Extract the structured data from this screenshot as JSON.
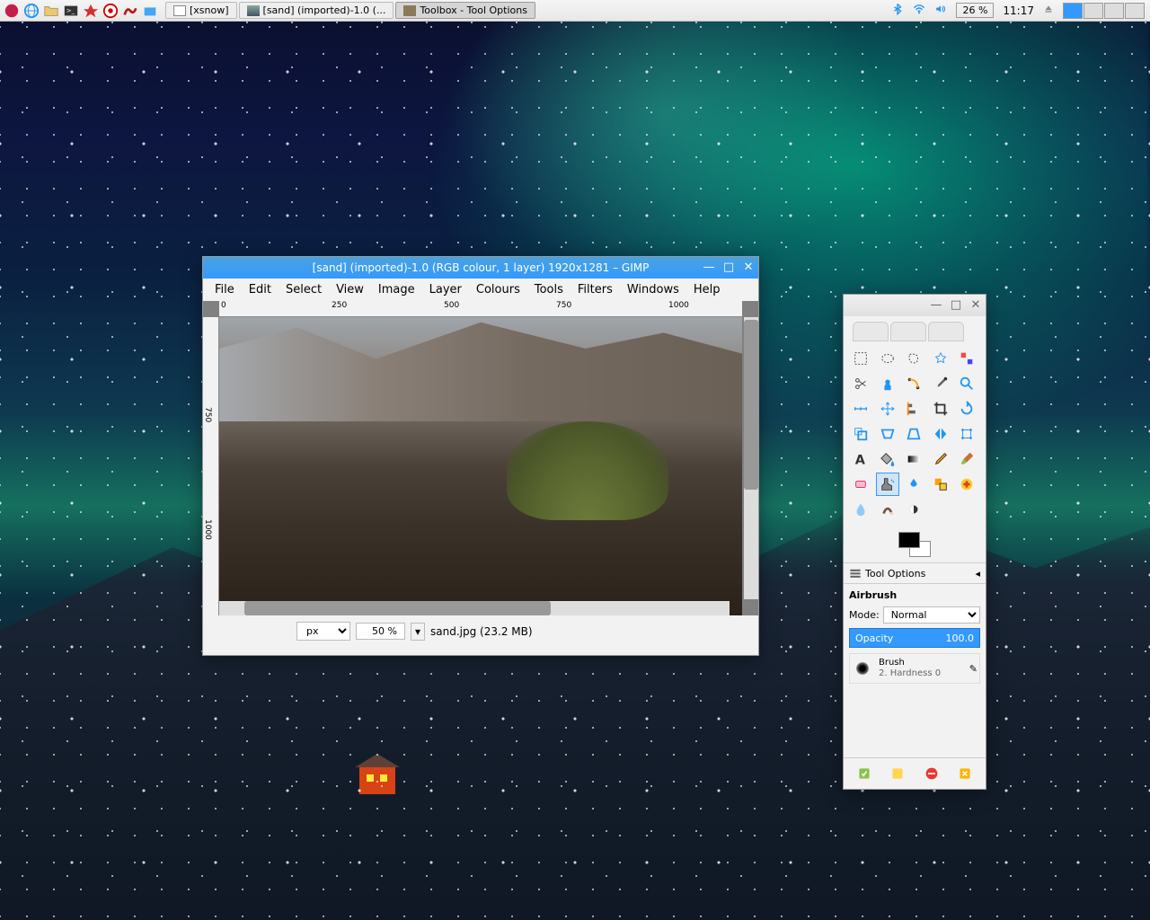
{
  "taskbar": {
    "tasks": [
      {
        "label": "[xsnow]"
      },
      {
        "label": "[sand] (imported)-1.0 (..."
      },
      {
        "label": "Toolbox - Tool Options"
      }
    ],
    "battery": "26 %",
    "time": "11:17"
  },
  "gimp": {
    "title": "[sand] (imported)-1.0 (RGB colour, 1 layer) 1920x1281 – GIMP",
    "menus": [
      "File",
      "Edit",
      "Select",
      "View",
      "Image",
      "Layer",
      "Colours",
      "Tools",
      "Filters",
      "Windows",
      "Help"
    ],
    "ruler_h": [
      "0",
      "250",
      "500",
      "750",
      "1000"
    ],
    "ruler_v": [
      "750",
      "1000"
    ],
    "unit": "px",
    "zoom": "50 %",
    "status": "sand.jpg (23.2 MB)"
  },
  "toolbox": {
    "options_header": "Tool Options",
    "tool_name": "Airbrush",
    "mode_label": "Mode:",
    "mode_value": "Normal",
    "opacity_label": "Opacity",
    "opacity_value": "100.0",
    "brush_label": "Brush",
    "brush_name": "2. Hardness 0",
    "tools": [
      "rect-select",
      "ellipse-select",
      "free-select",
      "fuzzy-select",
      "color-select",
      "scissors",
      "foreground-select",
      "paths",
      "color-picker",
      "zoom",
      "measure",
      "move",
      "align",
      "crop",
      "rotate",
      "scale",
      "shear",
      "perspective",
      "flip",
      "cage",
      "text",
      "bucket-fill",
      "blend",
      "pencil",
      "paintbrush",
      "eraser",
      "airbrush",
      "ink",
      "clone",
      "heal",
      "blur",
      "smudge",
      "dodge"
    ],
    "active_tool": "airbrush"
  }
}
